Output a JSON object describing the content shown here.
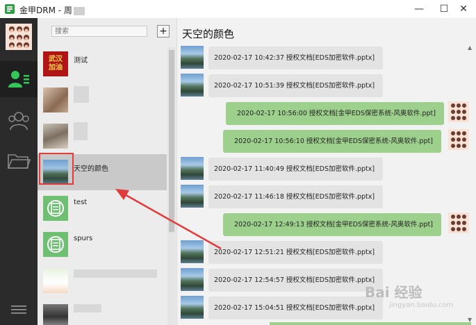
{
  "window": {
    "title": "金甲DRM - 周",
    "min_glyph": "—",
    "max_glyph": "☐",
    "close_glyph": "✕"
  },
  "sidebar": {
    "search_placeholder": "搜索",
    "add_label": "+",
    "contacts": [
      {
        "name": "测试",
        "avatar_text_1": "武汉",
        "avatar_text_2": "加油",
        "avatar": "red-badge"
      },
      {
        "name": "",
        "avatar": "blurred-photo",
        "masked": true
      },
      {
        "name": "",
        "avatar": "blurred-photo",
        "masked": true
      },
      {
        "name": "天空的颜色",
        "avatar": "sky-photo",
        "selected": true
      },
      {
        "name": "test",
        "avatar": "gold-seal-icon"
      },
      {
        "name": "spurs",
        "avatar": "gold-seal-icon"
      },
      {
        "name": "",
        "avatar": "cartoon",
        "masked": true
      },
      {
        "name": "",
        "avatar": "blurred-photo",
        "masked": true
      }
    ]
  },
  "chat": {
    "title": "天空的颜色",
    "messages": [
      {
        "dir": "in",
        "text": "2020-02-17 10:42:37    授权文档[EDS加密软件.pptx]"
      },
      {
        "dir": "in",
        "text": "2020-02-17 10:51:39    授权文档[EDS加密软件.pptx]"
      },
      {
        "dir": "out",
        "text": "2020-02-17 10:56:00    授权文档[金甲EDS保密系统-风奥软件.ppt]"
      },
      {
        "dir": "out",
        "text": "2020-02-17 10:56:10    授权文档[金甲EDS保密系统-风奥软件.ppt]"
      },
      {
        "dir": "in",
        "text": "2020-02-17 11:40:49    授权文档[EDS加密软件.pptx]"
      },
      {
        "dir": "in",
        "text": "2020-02-17 11:46:18    授权文档[EDS加密软件.pptx]"
      },
      {
        "dir": "out",
        "text": "2020-02-17 12:49:13    授权文档[金甲EDS保密系统-风奥软件.ppt]"
      },
      {
        "dir": "in",
        "text": "2020-02-17 12:51:21    授权文档[EDS加密软件.pptx]"
      },
      {
        "dir": "in",
        "text": "2020-02-17 12:54:57    授权文档[EDS加密软件.pptx]"
      },
      {
        "dir": "in",
        "text": "2020-02-17 15:04:51    授权文档[EDS加密软件.pptx]"
      }
    ]
  },
  "watermark": {
    "text": "Bai 经验",
    "sub": "jingyan.baidu.com"
  },
  "colors": {
    "rail_bg": "#2b2b2b",
    "rail_active_icon": "#34c759",
    "outgoing_bubble": "#9ed08d",
    "incoming_bubble": "#e3e3e3",
    "annotation_red": "#e23b3b"
  }
}
